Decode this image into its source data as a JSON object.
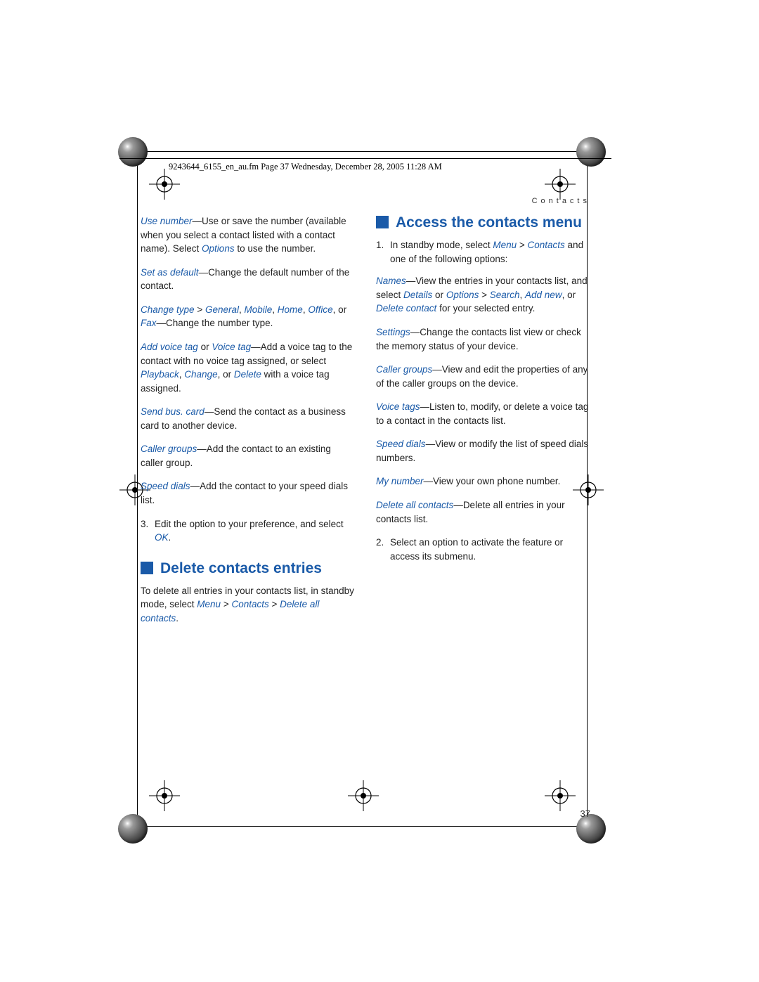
{
  "header": "9243644_6155_en_au.fm  Page 37  Wednesday, December 28, 2005  11:28 AM",
  "sectionLabel": "Contacts",
  "pageNumber": "37",
  "left": {
    "p1": {
      "t1": "Use number",
      "r1": "—Use or save the number (available when you select a contact listed with a contact name). Select ",
      "t2": "Options",
      "r2": " to use the number."
    },
    "p2": {
      "t1": "Set as default",
      "r1": "—Change the default number of the contact."
    },
    "p3": {
      "t1": "Change type",
      "g": " > ",
      "t2": "General",
      "c1": ", ",
      "t3": "Mobile",
      "c2": ", ",
      "t4": "Home",
      "c3": ", ",
      "t5": "Office",
      "c4": ", or ",
      "t6": "Fax",
      "r": "—Change the number type."
    },
    "p4": {
      "t1": "Add voice tag",
      "mid": " or ",
      "t2": "Voice tag",
      "r1": "—Add a voice tag to the contact with no voice tag assigned, or select ",
      "t3": "Playback",
      "c1": ", ",
      "t4": "Change",
      "c2": ", or ",
      "t5": "Delete",
      "r2": " with a voice tag assigned."
    },
    "p5": {
      "t1": "Send bus. card",
      "r1": "—Send the contact as a business card to another device."
    },
    "p6": {
      "t1": "Caller groups",
      "r1": "—Add the contact to an existing caller group."
    },
    "p7": {
      "t1": "Speed dials",
      "r1": "—Add the contact to your speed dials list."
    },
    "p8": {
      "n": "3.",
      "r1": "Edit the option to your preference, and select ",
      "t1": "OK",
      "r2": "."
    },
    "h1": "Delete contacts entries",
    "p9": {
      "r1": "To delete all entries in your contacts list, in standby mode, select ",
      "t1": "Menu",
      "g1": " > ",
      "t2": "Contacts",
      "g2": " > ",
      "t3": "Delete all contacts",
      "r2": "."
    }
  },
  "right": {
    "h1": "Access the contacts menu",
    "p1": {
      "n": "1.",
      "r1": "In standby mode, select ",
      "t1": "Menu",
      "g1": " > ",
      "t2": "Contacts",
      "r2": " and one of the following options:"
    },
    "p2": {
      "t1": "Names",
      "r1": "—View the entries in your contacts list, and select ",
      "t2": "Details",
      "r2": " or ",
      "t3": "Options",
      "g1": " > ",
      "t4": "Search",
      "c1": ", ",
      "t5": "Add new",
      "c2": ", or ",
      "t6": "Delete contact",
      "r3": " for your selected entry."
    },
    "p3": {
      "t1": "Settings",
      "r1": "—Change the contacts list view or check the memory status of your device."
    },
    "p4": {
      "t1": "Caller groups",
      "r1": "—View and edit the properties of any of the caller groups on the device."
    },
    "p5": {
      "t1": "Voice tags",
      "r1": "—Listen to, modify, or delete a voice tag to a contact in the contacts list."
    },
    "p6": {
      "t1": "Speed dials",
      "r1": "—View or modify the list of speed dials numbers."
    },
    "p7": {
      "t1": "My number",
      "r1": "—View your own phone number."
    },
    "p8": {
      "t1": "Delete all contacts",
      "r1": "—Delete all entries in your contacts list."
    },
    "p9": {
      "n": "2.",
      "r1": "Select an option to activate the feature or access its submenu."
    }
  }
}
